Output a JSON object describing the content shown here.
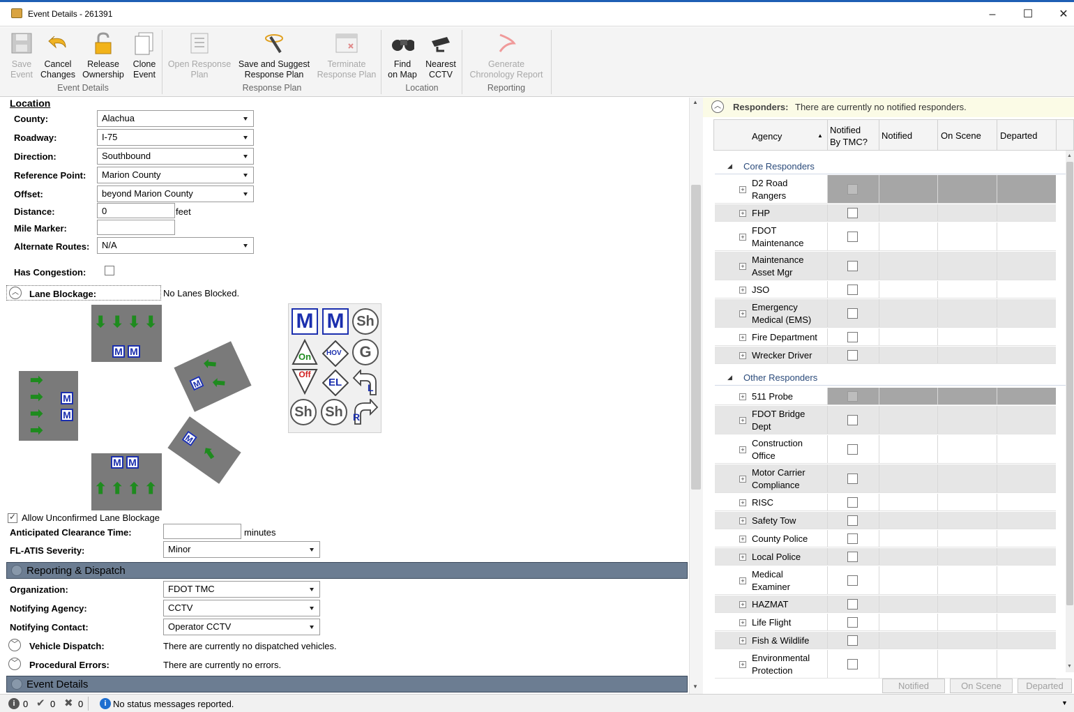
{
  "window": {
    "title": "Event Details - 261391",
    "minimize": "–",
    "maximize": "☐",
    "close": "✕"
  },
  "ribbon": {
    "buttons": {
      "save_event": "Save\nEvent",
      "cancel_changes": "Cancel\nChanges",
      "release_ownership": "Release\nOwnership",
      "clone_event": "Clone\nEvent",
      "open_response_plan": "Open Response\nPlan",
      "save_suggest": "Save and Suggest\nResponse Plan",
      "terminate_plan": "Terminate\nResponse Plan",
      "find_on_map": "Find\non Map",
      "nearest_cctv": "Nearest\nCCTV",
      "generate_report": "Generate\nChronology Report"
    },
    "groups": {
      "event_details": "Event Details",
      "response_plan": "Response Plan",
      "location": "Location",
      "reporting": "Reporting"
    }
  },
  "location": {
    "header": "Location",
    "county_label": "County:",
    "county": "Alachua",
    "roadway_label": "Roadway:",
    "roadway": "I-75",
    "direction_label": "Direction:",
    "direction": "Southbound",
    "refpoint_label": "Reference Point:",
    "refpoint": "Marion County",
    "offset_label": "Offset:",
    "offset": "beyond Marion County",
    "distance_label": "Distance:",
    "distance": "0",
    "distance_unit": "feet",
    "milemarker_label": "Mile Marker:",
    "milemarker": "",
    "altroutes_label": "Alternate Routes:",
    "altroutes": "N/A",
    "congestion_label": "Has Congestion:",
    "lane_blockage_label": "Lane Blockage:",
    "lane_blockage_value": "No Lanes Blocked.",
    "allow_unconfirmed": "Allow Unconfirmed Lane Blockage",
    "clearance_label": "Anticipated Clearance Time:",
    "clearance_unit": "minutes",
    "severity_label": "FL-ATIS Severity:",
    "severity": "Minor"
  },
  "lane_icons": {
    "m": "M",
    "sh": "Sh",
    "on": "On",
    "off": "Off",
    "hov": "HOV",
    "g": "G",
    "el": "EL",
    "l": "L",
    "r": "R"
  },
  "reporting": {
    "header": "Reporting & Dispatch",
    "org_label": "Organization:",
    "org": "FDOT TMC",
    "agency_label": "Notifying Agency:",
    "agency": "CCTV",
    "contact_label": "Notifying Contact:",
    "contact": "Operator CCTV",
    "vehicle_label": "Vehicle Dispatch:",
    "vehicle_value": "There are currently no dispatched vehicles.",
    "errors_label": "Procedural Errors:",
    "errors_value": "There are currently no errors."
  },
  "event_details_header": "Event Details",
  "responders": {
    "label": "Responders:",
    "message": "There are currently no notified responders.",
    "columns": {
      "agency": "Agency",
      "notified_by_tmc": "Notified\nBy TMC?",
      "notified": "Notified",
      "on_scene": "On Scene",
      "departed": "Departed"
    },
    "core_group": "Core Responders",
    "core": [
      "D2 Road\nRangers",
      "FHP",
      "FDOT\nMaintenance",
      "Maintenance\nAsset Mgr",
      "JSO",
      "Emergency\nMedical (EMS)",
      "Fire Department",
      "Wrecker Driver"
    ],
    "other_group": "Other Responders",
    "other": [
      "511 Probe",
      "FDOT Bridge\nDept",
      "Construction\nOffice",
      "Motor Carrier\nCompliance",
      "RISC",
      "Safety Tow",
      "County Police",
      "Local Police",
      "Medical\nExaminer",
      "HAZMAT",
      "Life Flight",
      "Fish & Wildlife",
      "Environmental\nProtection"
    ],
    "buttons": {
      "notified": "Notified",
      "on_scene": "On Scene",
      "departed": "Departed"
    }
  },
  "status": {
    "info_count": "0",
    "ok_count": "0",
    "err_count": "0",
    "message": "No status messages reported."
  }
}
